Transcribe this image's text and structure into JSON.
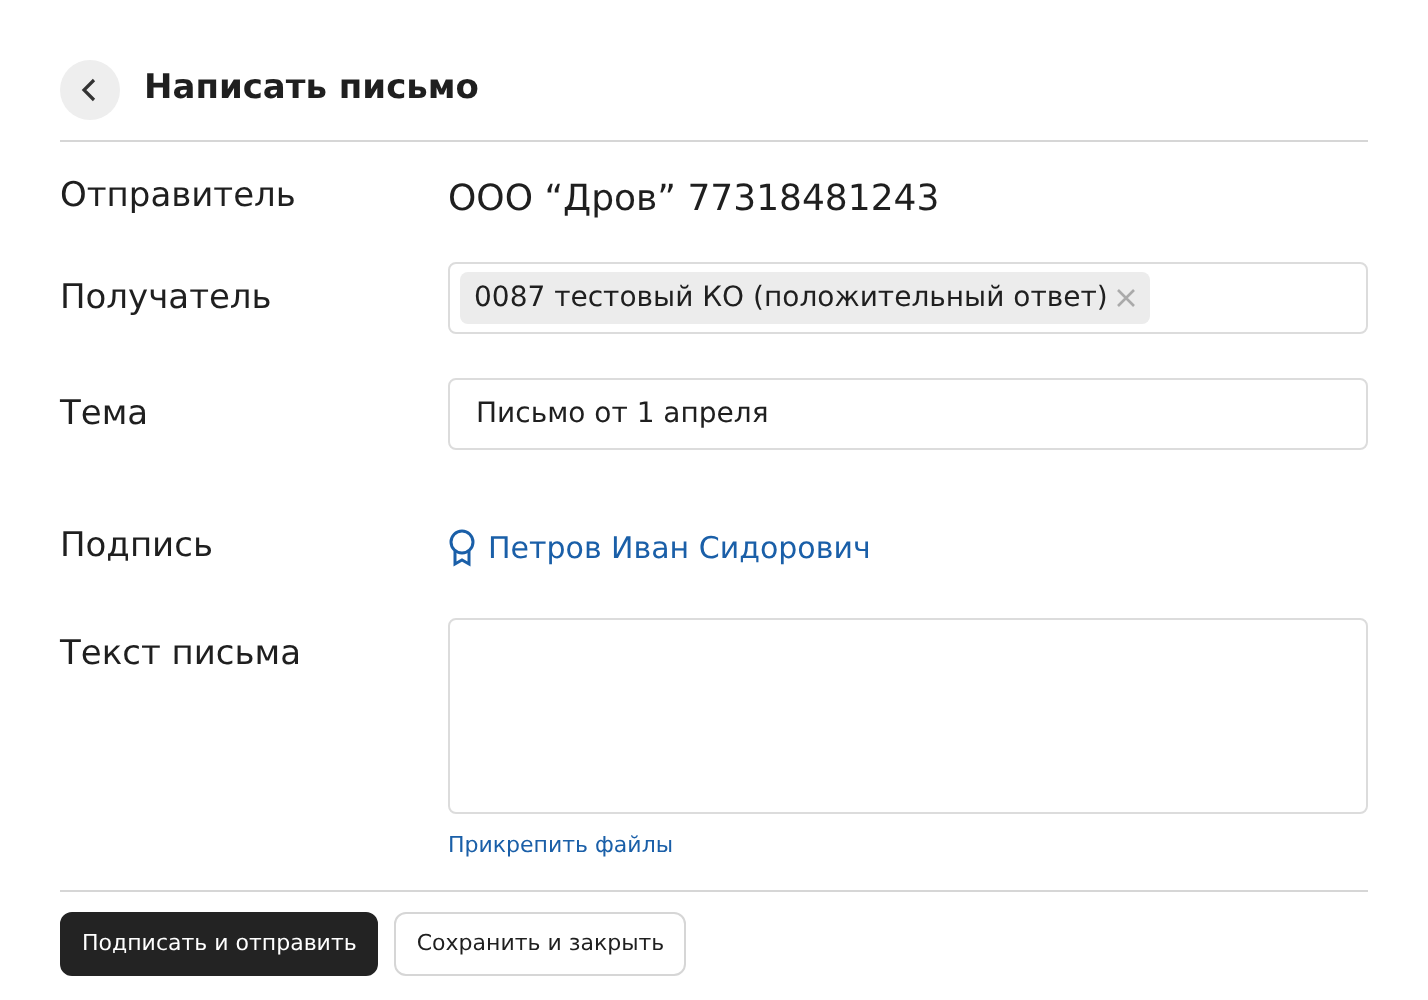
{
  "header": {
    "title": "Написать письмо"
  },
  "fields": [
    {
      "kind": "text",
      "label": "Отправитель",
      "value": "ООО “Дров” 77318481243"
    },
    {
      "kind": "chips",
      "label": "Получатель",
      "chips": [
        "0087 тестовый КО (положительный ответ)"
      ]
    },
    {
      "kind": "input",
      "label": "Тема",
      "value": "Письмо от 1 апреля"
    },
    {
      "kind": "signer",
      "label": "Подпись",
      "value": "Петров Иван Сидорович"
    },
    {
      "kind": "textarea",
      "label": "Текст письма",
      "link": "Прикрепить файлы"
    }
  ],
  "buttons": [
    {
      "label": "Подписать и отправить",
      "kind": "primary"
    },
    {
      "label": "Сохранить и закрыть",
      "kind": "secondary"
    }
  ]
}
